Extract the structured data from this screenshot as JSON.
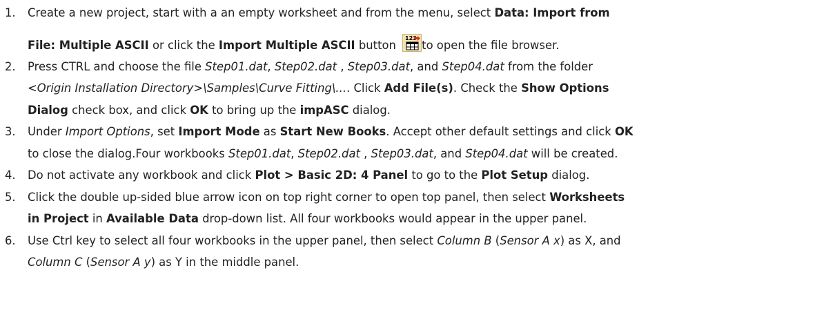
{
  "steps": [
    {
      "num": "1.",
      "t1": "Create a new project, start with a an empty worksheet and from the menu, select ",
      "b1": "Data: Import from",
      "b2": "File: Multiple ASCII",
      "t2": " or click the ",
      "b3": "Import Multiple ASCII",
      "t3": " button ",
      "t4": "to open the file browser.",
      "icon": "import-multiple-ascii-icon",
      "icon_text": "123"
    },
    {
      "num": "2.",
      "t1": "Press CTRL and choose the file ",
      "i1": "Step01.dat",
      "t2": ", ",
      "i2": "Step02.dat",
      "t3": " , ",
      "i3": "Step03.dat",
      "t4": ", and ",
      "i4": "Step04.dat",
      "t5": " from the folder",
      "i5": "<Origin Installation Directory>\\Samples\\Curve Fitting\\...",
      "t6": ". Click ",
      "b1": "Add File(s)",
      "t7": ". Check the ",
      "b2": "Show Options",
      "b3": "Dialog",
      "t8": " check box, and click ",
      "b4": "OK",
      "t9": " to bring up the ",
      "b5": "impASC",
      "t10": " dialog."
    },
    {
      "num": "3.",
      "t1": "Under ",
      "i1": "Import Options",
      "t2": ", set ",
      "b1": "Import Mode",
      "t3": " as ",
      "b2": "Start New Books",
      "t4": ". Accept other default settings and click ",
      "b3": "OK",
      "t5": "to close the dialog.Four workbooks ",
      "i2": "Step01.dat",
      "t6": ", ",
      "i3": "Step02.dat",
      "t7": " , ",
      "i4": "Step03.dat",
      "t8": ", and ",
      "i5": "Step04.dat",
      "t9": " will be created."
    },
    {
      "num": "4.",
      "t1": "Do not activate any workbook and click ",
      "b1": "Plot > Basic 2D: 4 Panel",
      "t2": " to go to the ",
      "b2": "Plot Setup",
      "t3": " dialog."
    },
    {
      "num": "5.",
      "t1": "Click the double up-sided blue arrow icon on top right corner to open top panel, then select ",
      "b1": "Worksheets",
      "b2": "in Project",
      "t2": " in ",
      "b3": "Available Data",
      "t3": " drop-down list. All four workbooks would appear in the upper panel."
    },
    {
      "num": "6.",
      "t1": "Use Ctrl key to select all four workbooks in the upper panel, then select ",
      "i1": "Column B",
      "t2": " (",
      "i2": "Sensor A x",
      "t3": ") as X, and",
      "i3": "Column C",
      "t4": " (",
      "i4": "Sensor A y",
      "t5": ") as Y in the middle panel."
    }
  ],
  "colors": {
    "text": "#222222",
    "icon_bg": "#f3e3b0",
    "icon_arrow": "#d8271d",
    "icon_grid": "#000000"
  }
}
